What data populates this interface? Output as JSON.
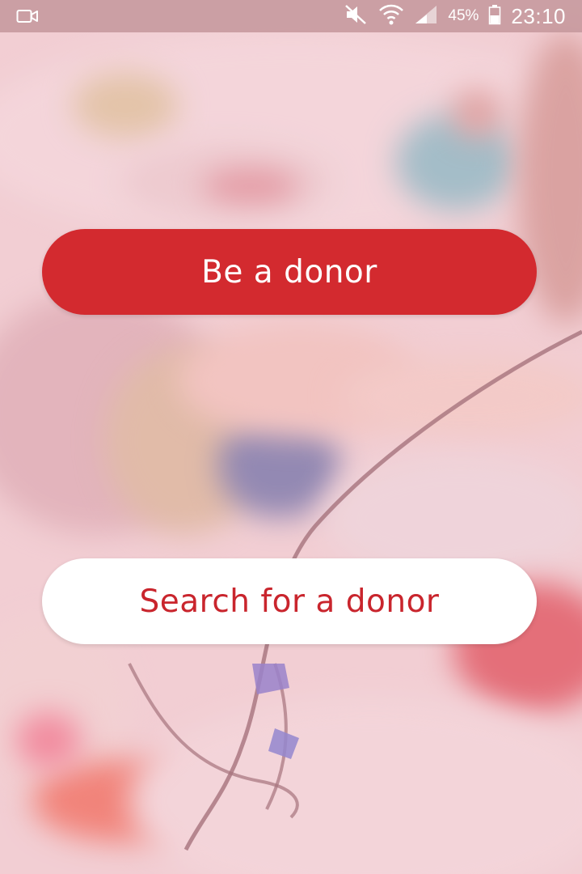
{
  "status_bar": {
    "battery_percent": "45%",
    "time": "23:10"
  },
  "actions": {
    "be_donor_label": "Be a donor",
    "search_donor_label": "Search for a donor"
  },
  "colors": {
    "primary_red": "#d32a2f",
    "button_white": "#ffffff",
    "search_text_red": "#c9252d"
  },
  "icons": {
    "camera": "video-camera-icon",
    "mute": "mute-icon",
    "wifi": "wifi-icon",
    "signal": "signal-icon",
    "battery": "battery-icon"
  }
}
